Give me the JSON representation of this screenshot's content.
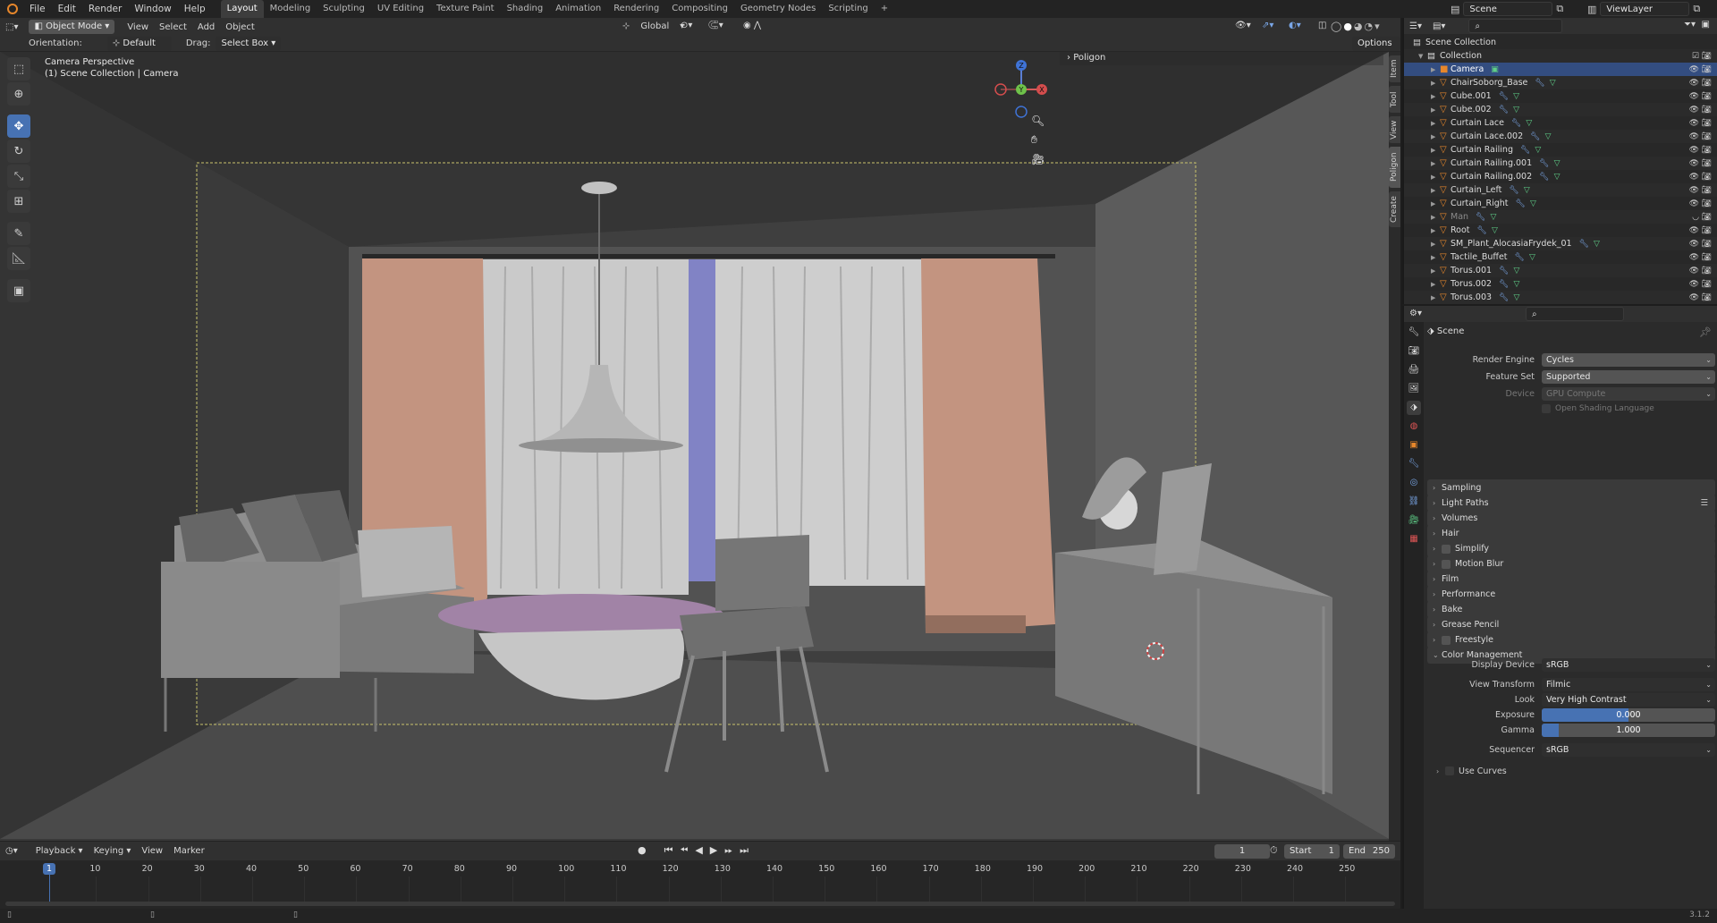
{
  "topbar": {
    "menus": [
      "File",
      "Edit",
      "Render",
      "Window",
      "Help"
    ],
    "workspaces": [
      "Layout",
      "Modeling",
      "Sculpting",
      "UV Editing",
      "Texture Paint",
      "Shading",
      "Animation",
      "Rendering",
      "Compositing",
      "Geometry Nodes",
      "Scripting"
    ],
    "active_workspace": "Layout",
    "add_tab": "+",
    "scene": "Scene",
    "view_layer": "ViewLayer"
  },
  "viewport_header": {
    "mode": "Object Mode",
    "menus": [
      "View",
      "Select",
      "Add",
      "Object"
    ],
    "transform_orientation": "Global",
    "orientation_label": "Orientation:",
    "orientation_value": "Default",
    "drag_label": "Drag:",
    "drag_value": "Select Box",
    "options": "Options"
  },
  "viewport": {
    "perspective": "Camera Perspective",
    "collection_path": "(1) Scene Collection | Camera",
    "panel_label": "Poligon",
    "gizmo_axes": {
      "z": "Z",
      "y": "Y",
      "x": "X"
    },
    "side_tabs": [
      "Item",
      "Tool",
      "View",
      "Poligon",
      "Create"
    ]
  },
  "timeline": {
    "menus": [
      "Playback",
      "Keying",
      "View",
      "Marker"
    ],
    "current_frame": "1",
    "start_label": "Start",
    "start": "1",
    "end_label": "End",
    "end": "250",
    "ticks": [
      "1",
      "10",
      "20",
      "30",
      "40",
      "50",
      "60",
      "70",
      "80",
      "90",
      "100",
      "110",
      "120",
      "130",
      "140",
      "150",
      "160",
      "170",
      "180",
      "190",
      "200",
      "210",
      "220",
      "230",
      "240",
      "250"
    ]
  },
  "outliner": {
    "root": "Scene Collection",
    "collection": "Collection",
    "items": [
      {
        "name": "Camera",
        "selected": true,
        "dim": false
      },
      {
        "name": "ChairSoborg_Base",
        "selected": false,
        "dim": false
      },
      {
        "name": "Cube.001",
        "selected": false,
        "dim": false
      },
      {
        "name": "Cube.002",
        "selected": false,
        "dim": false
      },
      {
        "name": "Curtain Lace",
        "selected": false,
        "dim": false
      },
      {
        "name": "Curtain Lace.002",
        "selected": false,
        "dim": false
      },
      {
        "name": "Curtain Railing",
        "selected": false,
        "dim": false
      },
      {
        "name": "Curtain Railing.001",
        "selected": false,
        "dim": false
      },
      {
        "name": "Curtain Railing.002",
        "selected": false,
        "dim": false
      },
      {
        "name": "Curtain_Left",
        "selected": false,
        "dim": false
      },
      {
        "name": "Curtain_Right",
        "selected": false,
        "dim": false
      },
      {
        "name": "Man",
        "selected": false,
        "dim": true
      },
      {
        "name": "Root",
        "selected": false,
        "dim": false
      },
      {
        "name": "SM_Plant_AlocasiaFrydek_01",
        "selected": false,
        "dim": false
      },
      {
        "name": "Tactile_Buffet",
        "selected": false,
        "dim": false
      },
      {
        "name": "Torus.001",
        "selected": false,
        "dim": false
      },
      {
        "name": "Torus.002",
        "selected": false,
        "dim": false
      },
      {
        "name": "Torus.003",
        "selected": false,
        "dim": false
      }
    ]
  },
  "properties": {
    "context": "Scene",
    "render_engine_label": "Render Engine",
    "render_engine": "Cycles",
    "feature_set_label": "Feature Set",
    "feature_set": "Supported",
    "device_label": "Device",
    "device": "GPU Compute",
    "osl_label": "Open Shading Language",
    "panels": [
      "Sampling",
      "Light Paths",
      "Volumes",
      "Hair",
      "Simplify",
      "Motion Blur",
      "Film",
      "Performance",
      "Bake",
      "Grease Pencil",
      "Freestyle",
      "Color Management"
    ],
    "color_management": {
      "display_device_label": "Display Device",
      "display_device": "sRGB",
      "view_transform_label": "View Transform",
      "view_transform": "Filmic",
      "look_label": "Look",
      "look": "Very High Contrast",
      "exposure_label": "Exposure",
      "exposure": "0.000",
      "gamma_label": "Gamma",
      "gamma": "1.000",
      "gamma_fill": 0.1,
      "exposure_fill": 0.5,
      "sequencer_label": "Sequencer",
      "sequencer": "sRGB",
      "use_curves_label": "Use Curves"
    }
  },
  "status": {
    "version": "3.1.2"
  },
  "colors": {
    "accent": "#4772b3",
    "selection": "#334d80",
    "object_orange": "#e7872b",
    "mesh_green": "#5fcf88"
  }
}
